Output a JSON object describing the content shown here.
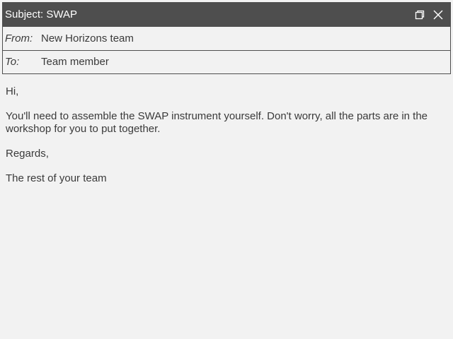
{
  "window": {
    "subject": "Subject: SWAP",
    "controls": {
      "restore_icon": "restore-icon",
      "close_icon": "close-icon"
    }
  },
  "header": {
    "from_label": "From:",
    "from_value": "New Horizons team",
    "to_label": "To:",
    "to_value": "Team member"
  },
  "message": {
    "greeting": "Hi,",
    "body": "You'll need to assemble the SWAP instrument yourself. Don't worry, all the parts are in the workshop for you to put together.",
    "signoff": "Regards,",
    "signature": "The rest of your team"
  },
  "colors": {
    "titlebar": "#4e4e4e",
    "background": "#f2f2f2",
    "text": "#3a3a3a"
  }
}
